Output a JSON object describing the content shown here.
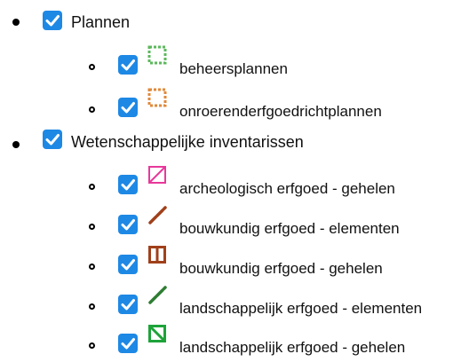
{
  "layers": [
    {
      "label": "Plannen",
      "checked": true,
      "children": [
        {
          "label": "beheersplannen",
          "checked": true,
          "legend_icon": "dashed-square-green",
          "legend_color": "#5cb85c"
        },
        {
          "label": "onroerenderfgoedrichtplannen",
          "checked": true,
          "legend_icon": "dashed-square-orange",
          "legend_color": "#e0893a"
        }
      ]
    },
    {
      "label": "Wetenschappelijke inventarissen",
      "checked": true,
      "children": [
        {
          "label": "archeologisch erfgoed - gehelen",
          "checked": true,
          "legend_icon": "square-diagonal-magenta",
          "legend_color": "#e8389a"
        },
        {
          "label": "bouwkundig erfgoed - elementen",
          "checked": true,
          "legend_icon": "line-brown",
          "legend_color": "#a0401a"
        },
        {
          "label": "bouwkundig erfgoed - gehelen",
          "checked": true,
          "legend_icon": "square-split-brown",
          "legend_color": "#a0401a"
        },
        {
          "label": "landschappelijk erfgoed - elementen",
          "checked": true,
          "legend_icon": "line-green",
          "legend_color": "#2e7d32"
        },
        {
          "label": "landschappelijk erfgoed - gehelen",
          "checked": true,
          "legend_icon": "square-diagonal-green",
          "legend_color": "#1ea339"
        }
      ]
    }
  ],
  "accent_color": "#1e88e5"
}
